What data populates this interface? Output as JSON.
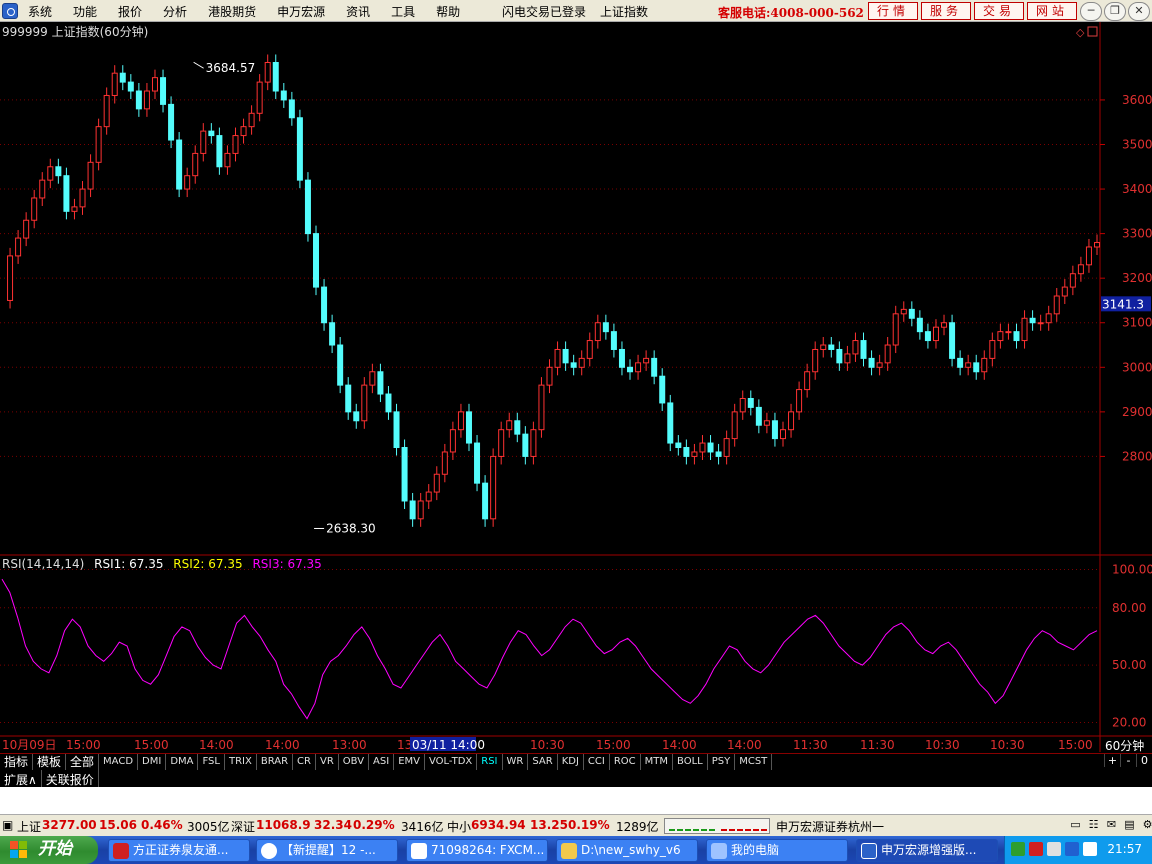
{
  "menubar": {
    "items": [
      "系统",
      "功能",
      "报价",
      "分析",
      "港股期货",
      "申万宏源",
      "资讯",
      "工具",
      "帮助"
    ],
    "status": [
      "闪电交易已登录",
      "上证指数"
    ],
    "phone": "客服电话:4008-000-562",
    "buttons": [
      "行情",
      "服务",
      "交易",
      "网站"
    ]
  },
  "chart_data": [
    {
      "type": "candlestick",
      "title": "999999 上证指数(60分钟)",
      "y_ticks": [
        2800,
        2900,
        3000,
        3100,
        3200,
        3300,
        3400,
        3500,
        3600
      ],
      "ylim": [
        2590,
        3730
      ],
      "annotations": [
        {
          "label": "3684.57",
          "x_index": 0.175,
          "value": 3684.57
        },
        {
          "label": "2638.30",
          "x_index": 0.285,
          "value": 2638.3
        }
      ],
      "current_label": "3141.3",
      "x_tick_labels": [
        "10月09日",
        "15:00",
        "15:00",
        "14:00",
        "14:00",
        "13:00",
        "13",
        "03/11 14:00",
        "10:30",
        "15:00",
        "14:00",
        "14:00",
        "11:30",
        "11:30",
        "10:30",
        "10:30",
        "15:00"
      ],
      "x_period_label": "60分钟",
      "close_series": [
        3150,
        3250,
        3290,
        3330,
        3380,
        3420,
        3450,
        3430,
        3350,
        3360,
        3400,
        3460,
        3540,
        3610,
        3660,
        3640,
        3620,
        3580,
        3620,
        3650,
        3590,
        3510,
        3400,
        3430,
        3480,
        3530,
        3520,
        3450,
        3480,
        3520,
        3540,
        3570,
        3640,
        3684,
        3620,
        3600,
        3560,
        3420,
        3300,
        3180,
        3100,
        3050,
        2960,
        2900,
        2880,
        2960,
        2990,
        2940,
        2900,
        2820,
        2700,
        2660,
        2700,
        2720,
        2760,
        2810,
        2860,
        2900,
        2830,
        2740,
        2660,
        2800,
        2860,
        2880,
        2850,
        2800,
        2860,
        2960,
        3000,
        3040,
        3010,
        3000,
        3020,
        3060,
        3100,
        3080,
        3040,
        3000,
        2990,
        3010,
        3020,
        2980,
        2920,
        2830,
        2820,
        2800,
        2810,
        2830,
        2810,
        2800,
        2840,
        2900,
        2930,
        2910,
        2870,
        2880,
        2840,
        2860,
        2900,
        2950,
        2990,
        3040,
        3050,
        3040,
        3010,
        3030,
        3060,
        3020,
        3000,
        3010,
        3050,
        3120,
        3130,
        3110,
        3080,
        3060,
        3090,
        3100,
        3020,
        3000,
        3010,
        2990,
        3020,
        3060,
        3080,
        3080,
        3060,
        3110,
        3100,
        3100,
        3120,
        3160,
        3180,
        3210,
        3230,
        3270,
        3280
      ]
    },
    {
      "type": "line",
      "title": "RSI(14,14,14)",
      "legend": [
        {
          "label": "RSI1: 67.35",
          "color": "#ffffff"
        },
        {
          "label": "RSI2: 67.35",
          "color": "#ffff00"
        },
        {
          "label": "RSI3: 67.35",
          "color": "#ff00ff"
        }
      ],
      "y_ticks": [
        20.0,
        50.0,
        80.0,
        100.0
      ],
      "ylim": [
        15,
        105
      ],
      "series_color": "#ff00ff",
      "values": [
        95,
        88,
        75,
        60,
        52,
        48,
        46,
        55,
        68,
        74,
        70,
        60,
        55,
        52,
        56,
        62,
        60,
        48,
        42,
        40,
        45,
        55,
        65,
        70,
        68,
        60,
        54,
        50,
        48,
        60,
        72,
        76,
        70,
        65,
        58,
        52,
        40,
        35,
        28,
        22,
        30,
        45,
        52,
        55,
        60,
        66,
        70,
        64,
        55,
        48,
        40,
        38,
        44,
        50,
        56,
        62,
        66,
        60,
        52,
        48,
        44,
        40,
        38,
        45,
        54,
        62,
        68,
        66,
        60,
        55,
        58,
        64,
        70,
        74,
        72,
        66,
        60,
        56,
        58,
        62,
        64,
        60,
        54,
        48,
        44,
        40,
        36,
        32,
        30,
        34,
        40,
        48,
        54,
        60,
        58,
        52,
        48,
        46,
        50,
        56,
        62,
        66,
        70,
        74,
        76,
        72,
        66,
        60,
        56,
        52,
        50,
        54,
        60,
        66,
        70,
        72,
        68,
        62,
        58,
        56,
        60,
        62,
        58,
        52,
        46,
        40,
        36,
        30,
        34,
        42,
        50,
        58,
        64,
        68,
        66,
        62,
        60,
        58,
        62,
        66,
        68
      ]
    }
  ],
  "indicator_tabs": {
    "label_tabs": [
      "指标",
      "模板",
      "全部"
    ],
    "tabs": [
      "MACD",
      "DMI",
      "DMA",
      "FSL",
      "TRIX",
      "BRAR",
      "CR",
      "VR",
      "OBV",
      "ASI",
      "EMV",
      "VOL-TDX",
      "RSI",
      "WR",
      "SAR",
      "KDJ",
      "CCI",
      "ROC",
      "MTM",
      "BOLL",
      "PSY",
      "MCST"
    ],
    "active": "RSI",
    "right": [
      "+",
      "-",
      "0"
    ]
  },
  "expand_bar": [
    "扩展∧",
    "关联报价"
  ],
  "statusbar": {
    "sh": {
      "name": "上证",
      "value": "3277.00",
      "change": "15.06",
      "pct": "0.46%",
      "vol": "3005亿"
    },
    "sz": {
      "name": "深证",
      "value": "11068.9",
      "change": "32.34",
      "pct": "0.29%",
      "vol": "3416亿"
    },
    "zx": {
      "name": "中小",
      "value": "6934.94",
      "change": "13.25",
      "pct": "0.19%",
      "vol": "1289亿"
    },
    "broker": "申万宏源证券杭州一"
  },
  "taskbar": {
    "start": "开始",
    "tasks": [
      "方正证券泉友通...",
      "【新提醒】12 -...",
      "71098264: FXCM...",
      "D:\\new_swhy_v6",
      "我的电脑",
      "申万宏源增强版..."
    ],
    "clock": "21:57"
  }
}
